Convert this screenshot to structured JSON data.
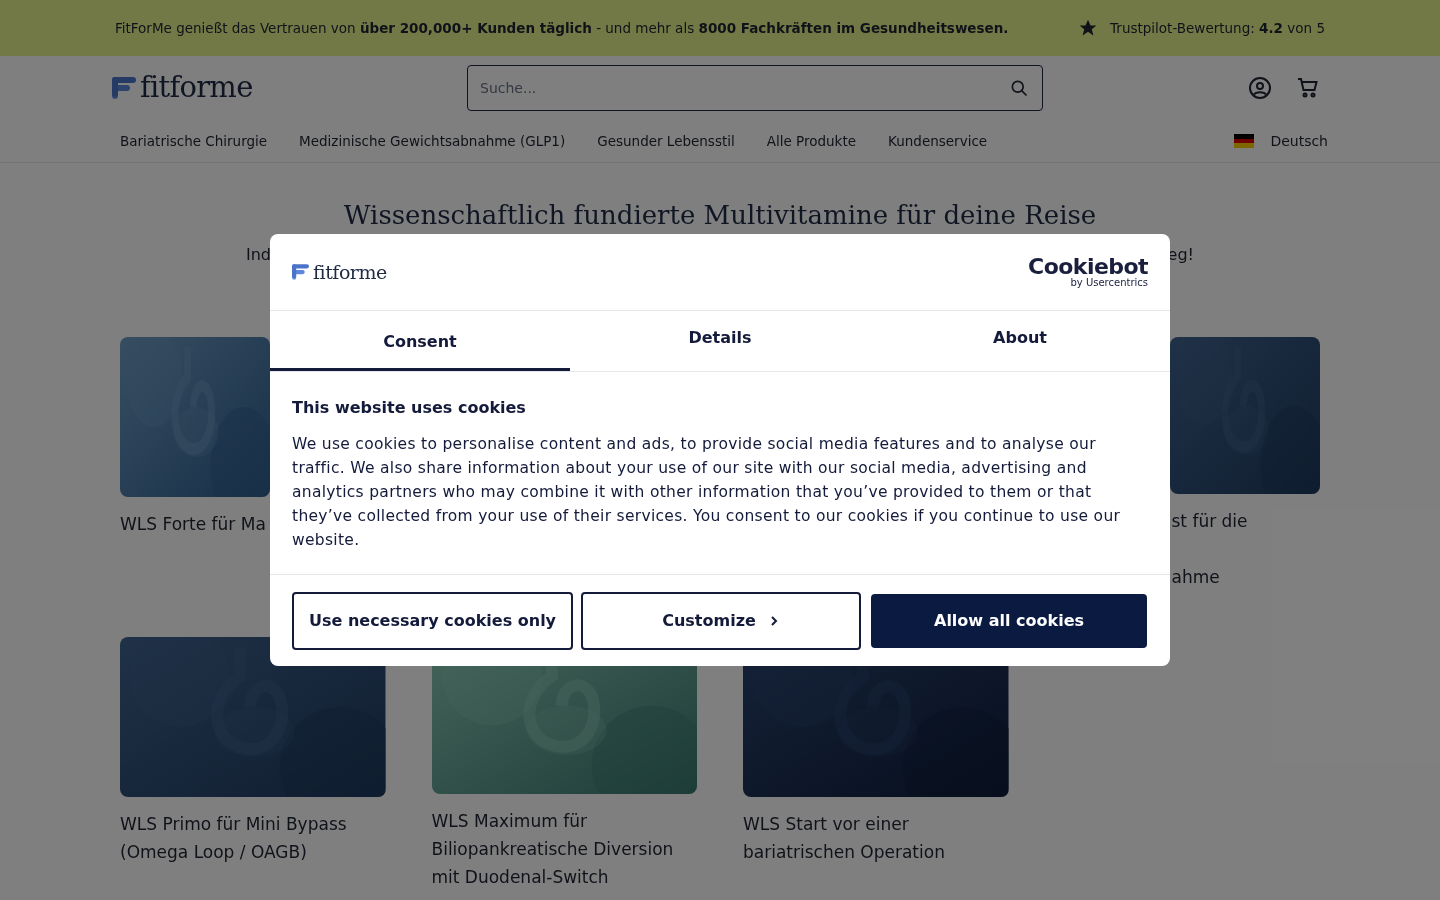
{
  "banner": {
    "text": "FitForMe genießt das Vertrauen von **über 200,000+ Kunden täglich** - und mehr als **8000 Fachkräften im Gesundheitswesen.**",
    "rating": "Trustpilot-Bewertung: **4.2** von 5"
  },
  "header": {
    "logo": "fitforme",
    "search": {
      "placeholder": "Suche..."
    }
  },
  "nav": {
    "items": [
      {
        "label": "Bariatrische Chirurgie"
      },
      {
        "label": "Medizinische Gewichtsabnahme (GLP1)"
      },
      {
        "label": "Gesunder Lebensstil"
      },
      {
        "label": "Alle Produkte"
      },
      {
        "label": "Kundenservice"
      }
    ],
    "language": "Deutsch"
  },
  "hero": {
    "title": "Wissenschaftlich fundierte Multivitamine für deine Reise",
    "subtitle_left": "Ind",
    "subtitle_right": "eg!"
  },
  "products": [
    {
      "lines": [
        "WLS Forte für Ma"
      ],
      "kind": "picture",
      "partial": true
    },
    {
      "lines": [
        "st für die",
        "ahme"
      ],
      "kind": "picture",
      "offset": true,
      "partial": true
    },
    {
      "lines": [
        "WLS Primo für Mini Bypass",
        "(Omega Loop / OAGB)"
      ],
      "kind": "picture"
    },
    {
      "lines": [
        "WLS Maximum für",
        "Biliopankreatische Diversion",
        "mit Duodenal-Switch"
      ],
      "kind": "picture"
    },
    {
      "lines": [
        "WLS Start vor einer",
        "bariatrischen Operation"
      ],
      "kind": "picture"
    }
  ],
  "cookie_dialog": {
    "logo": "fitforme",
    "brand": "Cookiebot",
    "brand_sub": "by Usercentrics",
    "tabs": [
      {
        "label": "Consent",
        "selected": true
      },
      {
        "label": "Details",
        "selected": false
      },
      {
        "label": "About",
        "selected": false
      }
    ],
    "heading": "This website uses cookies",
    "body": "We use cookies to personalise content and ads, to provide social media features and to analyse our traffic. We also share information about your use of our site with our social media, advertising and analytics partners who may combine it with other information that you’ve provided to them or that they’ve collected from your use of their services. You consent to our cookies if you continue to use our website.",
    "buttons": [
      {
        "label": "Use necessary cookies only",
        "kind": "outline"
      },
      {
        "label": "Customize",
        "kind": "chevron"
      },
      {
        "label": "Allow all cookies",
        "kind": "primary"
      }
    ]
  }
}
